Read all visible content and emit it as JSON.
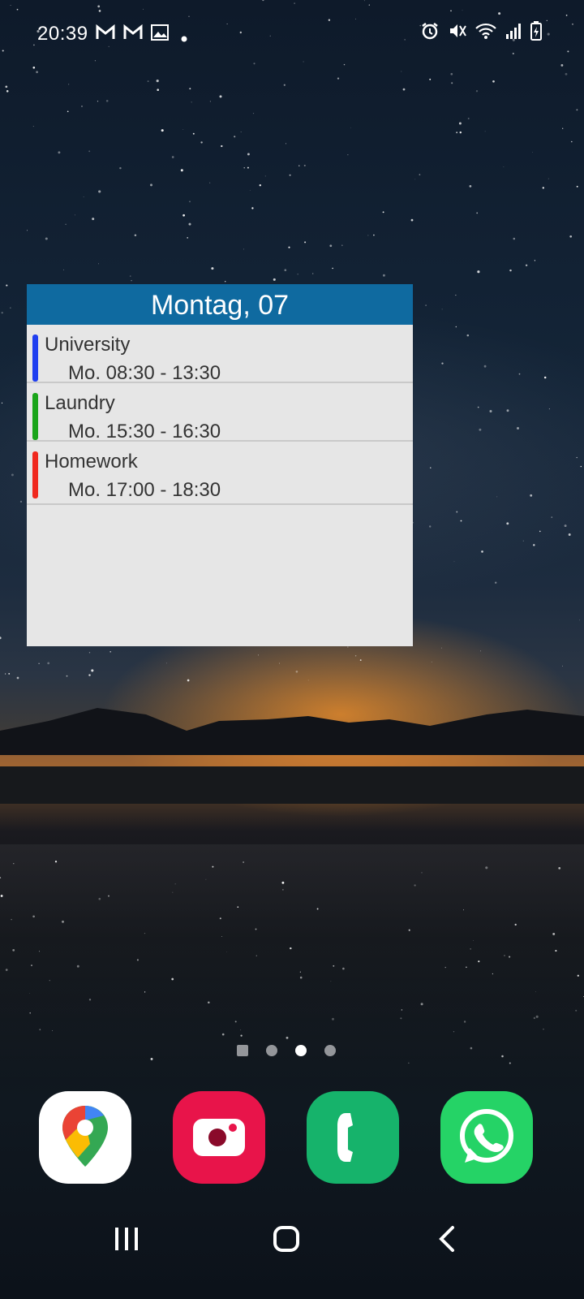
{
  "status_bar": {
    "time": "20:39",
    "left_icons": [
      "gmail-icon",
      "gmail-icon",
      "gallery-icon",
      "dot-icon"
    ],
    "right_icons": [
      "alarm-icon",
      "mute-icon",
      "wifi-icon",
      "signal-icon",
      "battery-icon"
    ]
  },
  "widget": {
    "header": "Montag, 07",
    "events": [
      {
        "title": "University",
        "time": "Mo. 08:30 - 13:30",
        "color": "#1f3ff0"
      },
      {
        "title": "Laundry",
        "time": "Mo. 15:30 - 16:30",
        "color": "#1aa51a"
      },
      {
        "title": "Homework",
        "time": "Mo. 17:00 - 18:30",
        "color": "#f0281e"
      }
    ]
  },
  "page_indicator": {
    "pages": 4,
    "active_index": 2
  },
  "dock": {
    "apps": [
      {
        "name": "maps-icon"
      },
      {
        "name": "screen-recorder-icon"
      },
      {
        "name": "phone-icon"
      },
      {
        "name": "whatsapp-icon"
      }
    ]
  },
  "nav_bar": {
    "buttons": [
      "recents-icon",
      "home-icon",
      "back-icon"
    ]
  }
}
